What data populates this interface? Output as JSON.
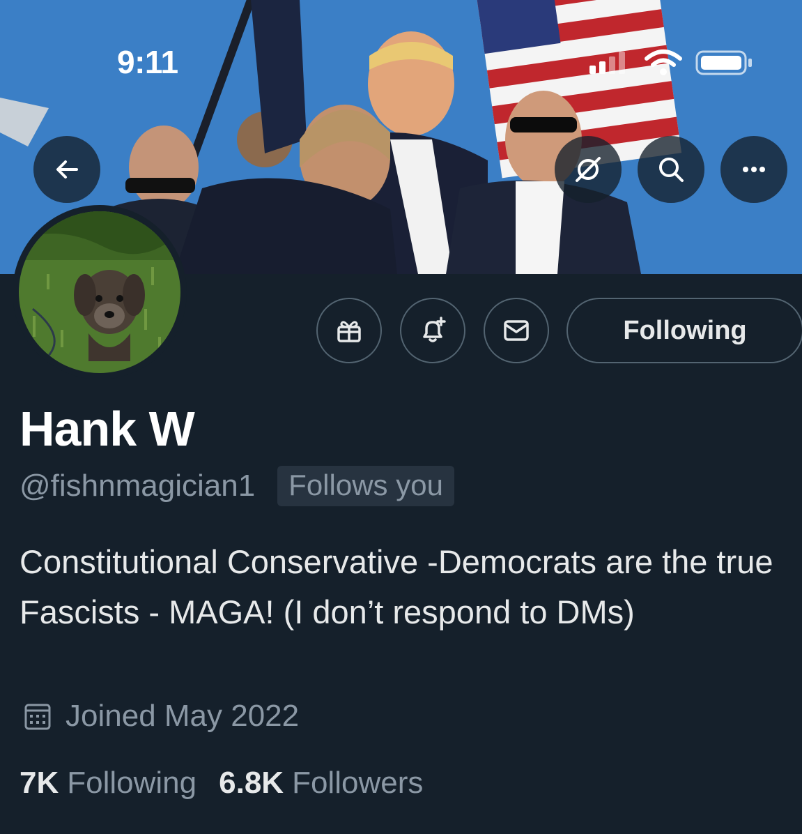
{
  "status_bar": {
    "time": "9:11",
    "icons": [
      "cellular-signal-icon",
      "wifi-icon",
      "battery-icon"
    ]
  },
  "header": {
    "back_icon": "arrow-left-icon",
    "grok_icon": "grok-icon",
    "search_icon": "search-icon",
    "more_icon": "more-horizontal-icon"
  },
  "profile": {
    "display_name": "Hank W",
    "handle": "@fishnmagician1",
    "follows_you_badge": "Follows you",
    "bio": "Constitutional Conservative -Democrats are the true Fascists - MAGA! (I don’t respond to DMs)",
    "joined": "Joined May 2022",
    "following_count": "7K",
    "following_label": "Following",
    "followers_count": "6.8K",
    "followers_label": "Followers"
  },
  "actions": {
    "gift_icon": "gift-icon",
    "notify_icon": "bell-plus-icon",
    "message_icon": "envelope-icon",
    "follow_button_label": "Following"
  },
  "colors": {
    "background": "#15202b",
    "primary_text": "#e7e9ea",
    "secondary_text": "#8b98a5",
    "border": "#536471",
    "badge_bg": "#273340"
  }
}
